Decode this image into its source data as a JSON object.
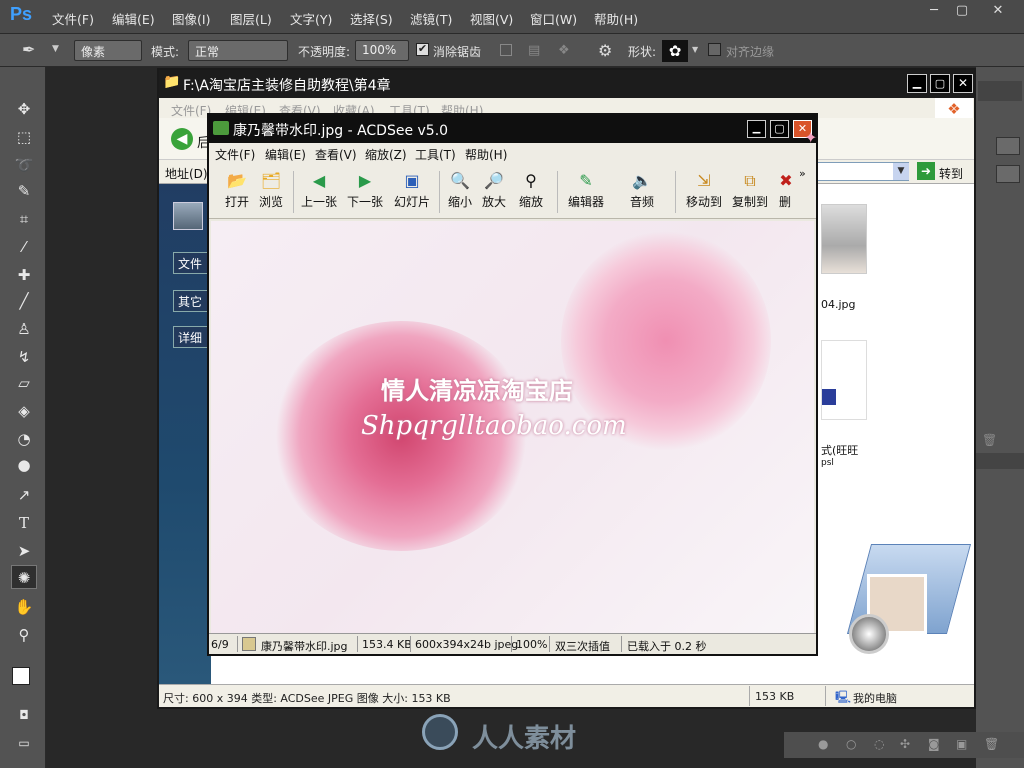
{
  "photoshop": {
    "logo": "Ps",
    "menu": [
      "文件(F)",
      "编辑(E)",
      "图像(I)",
      "图层(L)",
      "文字(Y)",
      "选择(S)",
      "滤镜(T)",
      "视图(V)",
      "窗口(W)",
      "帮助(H)"
    ],
    "window_controls": [
      "─",
      "▢",
      "✕"
    ],
    "options": {
      "tool_icon": "pen-icon",
      "mode_select": "像素",
      "mode_label": "模式:",
      "mode_value": "正常",
      "opacity_label": "不透明度:",
      "opacity_value": "100%",
      "antialias_label": "消除锯齿",
      "shape_label": "形状:",
      "align_edges_label": "对齐边缘"
    }
  },
  "explorer": {
    "title": "F:\\A淘宝店主装修自助教程\\第4章",
    "menu": [
      "文件(F)",
      "编辑(E)",
      "查看(V)",
      "收藏(A)",
      "工具(T)",
      "帮助(H)"
    ],
    "back_label": "后",
    "address_label": "地址(D)",
    "go_label": "转到",
    "side_buttons": [
      "文件",
      "其它",
      "详细"
    ],
    "file1_name": "04.jpg",
    "file2_name_line1": "式(旺旺",
    "file2_name_line2": "psl",
    "status_left": "尺寸: 600 x 394 类型: ACDSee JPEG 图像 大小: 153 KB",
    "status_size": "153 KB",
    "status_location": "我的电脑"
  },
  "acdsee": {
    "title": "康乃馨带水印.jpg - ACDSee v5.0",
    "menu": [
      "文件(F)",
      "编辑(E)",
      "查看(V)",
      "缩放(Z)",
      "工具(T)",
      "帮助(H)"
    ],
    "toolbar": [
      {
        "label": "打开",
        "icon": "open-folder-icon"
      },
      {
        "label": "浏览",
        "icon": "browse-icon"
      },
      {
        "label": "上一张",
        "icon": "prev-icon"
      },
      {
        "label": "下一张",
        "icon": "next-icon"
      },
      {
        "label": "幻灯片",
        "icon": "slideshow-icon"
      },
      {
        "label": "缩小",
        "icon": "zoom-out-icon"
      },
      {
        "label": "放大",
        "icon": "zoom-in-icon"
      },
      {
        "label": "缩放",
        "icon": "zoom-icon"
      },
      {
        "label": "编辑器",
        "icon": "editor-icon"
      },
      {
        "label": "音频",
        "icon": "audio-icon"
      },
      {
        "label": "移动到",
        "icon": "move-icon"
      },
      {
        "label": "复制到",
        "icon": "copy-icon"
      },
      {
        "label": "删",
        "icon": "delete-icon"
      }
    ],
    "image_watermark_line1": "情人清凉凉淘宝店",
    "image_watermark_line2": "Shpqrglltaobao.com",
    "status": {
      "index": "6/9",
      "filename": "康乃馨带水印.jpg",
      "filesize": "153.4 KB",
      "dimensions": "600x394x24b jpeg",
      "zoom": "100%",
      "interp": "双三次插值",
      "load_time": "已载入于 0.2 秒"
    }
  },
  "watermark": "人人素材",
  "colors": {
    "ps_bg": "#282828",
    "ps_panel": "#535353",
    "ps_blue": "#3fa0ff",
    "title_bar": "#0f0f0f",
    "explorer_side": "#1f4a6e"
  }
}
